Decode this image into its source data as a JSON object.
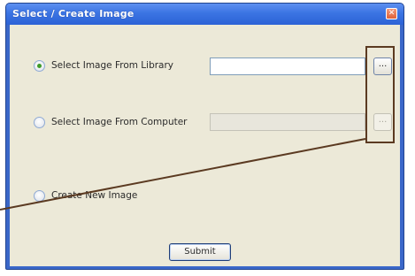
{
  "window": {
    "title": "Select / Create Image",
    "close_glyph": "✕"
  },
  "options": [
    {
      "label": "Select Image From Library",
      "checked": true,
      "field_value": "",
      "enabled": true,
      "browse_label": "..."
    },
    {
      "label": "Select Image From Computer",
      "checked": false,
      "field_value": "",
      "enabled": false,
      "browse_label": "..."
    },
    {
      "label": "Create New Image",
      "checked": false
    }
  ],
  "submit_label": "Submit",
  "colors": {
    "titlebar": "#3b74e3",
    "client_background": "#ece9d8",
    "annotation": "#5b3a21",
    "radio_checked": "#3f9b2a"
  }
}
